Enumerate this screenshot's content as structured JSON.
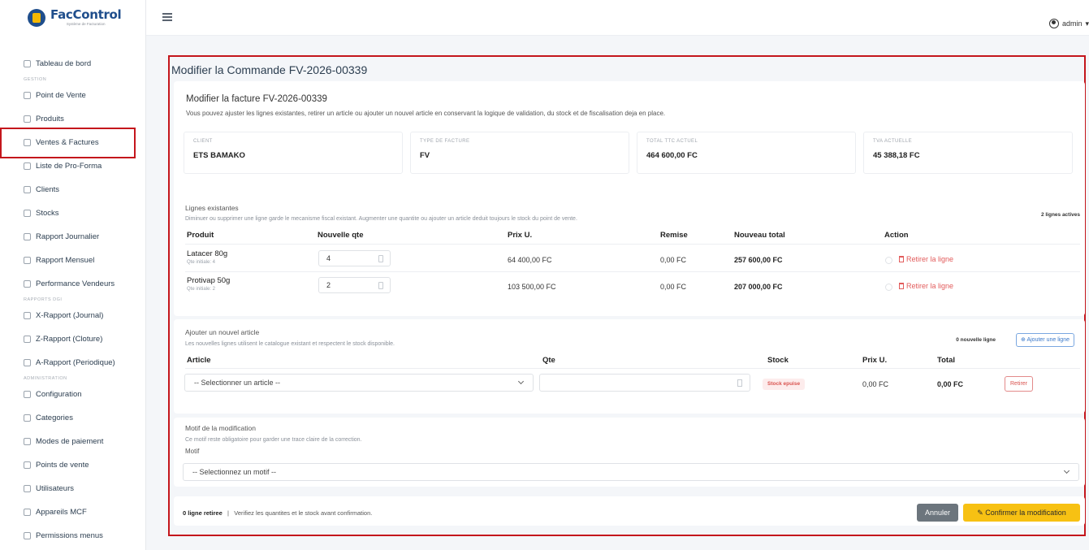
{
  "app": {
    "logo_title": "FacControl",
    "logo_subtitle": "Système de Facturation",
    "user": "admin"
  },
  "sidebar": {
    "dashboard": "Tableau de bord",
    "section_gestion": "GESTION",
    "items_gestion": [
      "Point de Vente",
      "Produits",
      "Ventes & Factures",
      "Liste de Pro-Forma",
      "Clients",
      "Stocks",
      "Rapport Journalier",
      "Rapport Mensuel",
      "Performance Vendeurs"
    ],
    "section_rapports": "RAPPORTS DGI",
    "items_rapports": [
      "X-Rapport (Journal)",
      "Z-Rapport (Cloture)",
      "A-Rapport (Periodique)"
    ],
    "section_admin": "ADMINISTRATION",
    "items_admin": [
      "Configuration",
      "Categories",
      "Modes de paiement",
      "Points de vente",
      "Utilisateurs",
      "Appareils MCF",
      "Permissions menus"
    ]
  },
  "page": {
    "title": "Modifier la Commande FV-2026-00339",
    "invoice_title": "Modifier la facture FV-2026-00339",
    "invoice_desc": "Vous pouvez ajuster les lignes existantes, retirer un article ou ajouter un nouvel article en conservant la logique de validation, du stock et de fiscalisation deja en place."
  },
  "summary": [
    {
      "label": "CLIENT",
      "value": "ETS BAMAKO"
    },
    {
      "label": "TYPE DE FACTURE",
      "value": "FV"
    },
    {
      "label": "TOTAL TTC ACTUEL",
      "value": "464 600,00 FC"
    },
    {
      "label": "TVA ACTUELLE",
      "value": "45 388,18 FC"
    }
  ],
  "existing": {
    "title": "Lignes existantes",
    "desc": "Diminuer ou supprimer une ligne garde le mecanisme fiscal existant. Augmenter une quantite ou ajouter un article deduit toujours le stock du point de vente.",
    "count": "2 lignes actives",
    "headers": [
      "Produit",
      "Nouvelle qte",
      "Prix U.",
      "Remise",
      "Nouveau total",
      "Action"
    ],
    "rows": [
      {
        "product": "Latacer 80g",
        "initial": "Qte initiale: 4",
        "qty": "4",
        "price": "64 400,00 FC",
        "discount": "0,00 FC",
        "total": "257 600,00 FC",
        "action": "Retirer la ligne"
      },
      {
        "product": "Protivap 50g",
        "initial": "Qte initiale: 2",
        "qty": "2",
        "price": "103 500,00 FC",
        "discount": "0,00 FC",
        "total": "207 000,00 FC",
        "action": "Retirer la ligne"
      }
    ]
  },
  "new_article": {
    "title": "Ajouter un nouvel article",
    "desc": "Les nouvelles lignes utilisent le catalogue existant et respectent le stock disponible.",
    "count": "0 nouvelle ligne",
    "add_button": "Ajouter une ligne",
    "headers": [
      "Article",
      "Qte",
      "Stock",
      "Prix U.",
      "Total"
    ],
    "select_placeholder": "-- Selectionner un article --",
    "stock_badge": "Stock epuise",
    "price": "0,00 FC",
    "total": "0,00 FC",
    "remove_button": "Retirer"
  },
  "reason": {
    "title": "Motif de la modification",
    "desc": "Ce motif reste obligatoire pour garder une trace claire de la correction.",
    "label": "Motif",
    "placeholder": "-- Selectionnez un motif --"
  },
  "footer": {
    "removed": "0 ligne retiree",
    "separator": "|",
    "hint": "Verifiez les quantites et le stock avant confirmation.",
    "cancel": "Annuler",
    "confirm": "Confirmer la modification"
  }
}
